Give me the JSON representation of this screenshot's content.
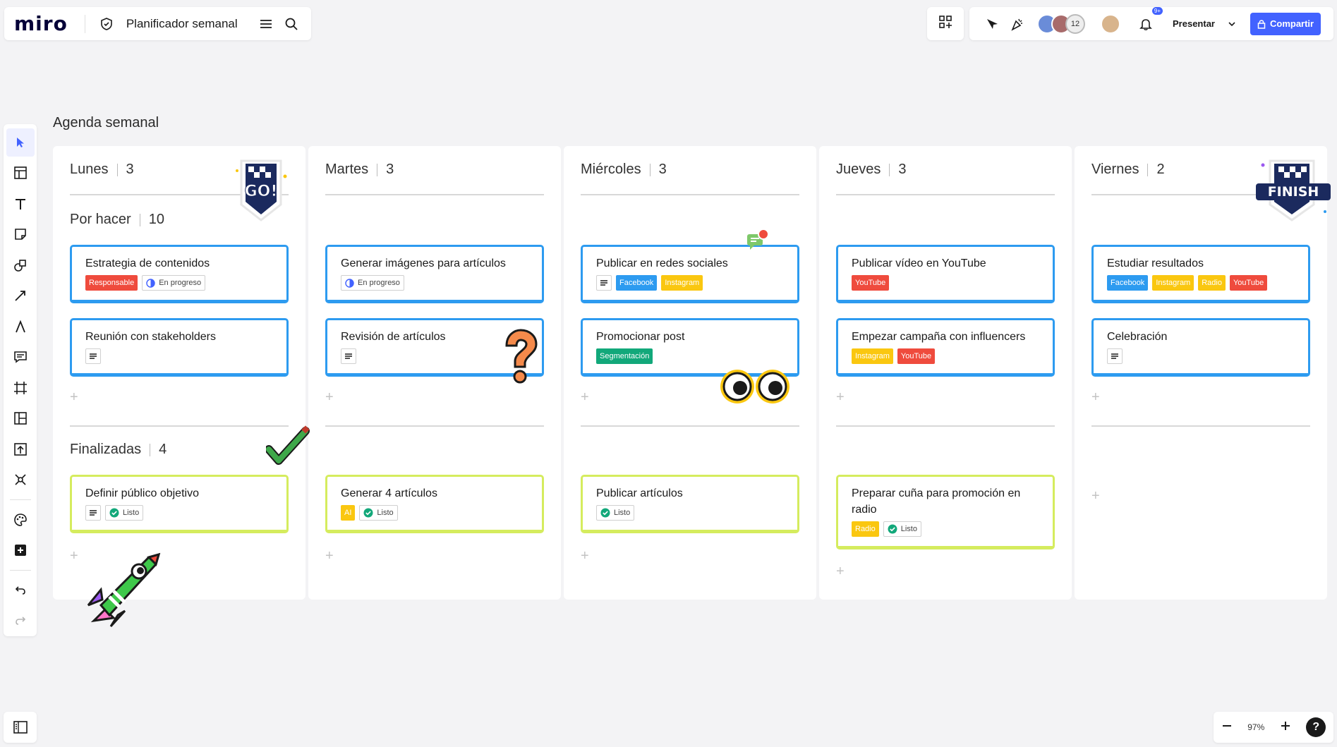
{
  "app": {
    "logo": "miro",
    "board_title": "Planificador semanal"
  },
  "topbar": {
    "avatar_count": "12",
    "notifications_badge": "9+",
    "present_label": "Presentar",
    "share_label": "Compartir"
  },
  "zoom": {
    "level": "97%",
    "help": "?"
  },
  "board": {
    "title": "Agenda semanal",
    "group_todo": "Por hacer",
    "group_todo_count": "10",
    "group_done": "Finalizadas",
    "group_done_count": "4",
    "columns": [
      {
        "day": "Lunes",
        "count": "3",
        "todo": [
          {
            "title": "Estrategia de contenidos",
            "tags": [
              {
                "label": "Responsable",
                "color": "#ef4b3d"
              },
              {
                "label": "En progreso",
                "kind": "status-progress"
              }
            ]
          },
          {
            "title": "Reunión con stakeholders",
            "note": true
          }
        ],
        "done": [
          {
            "title": "Definir público objetivo",
            "note": true,
            "tags": [
              {
                "label": "Listo",
                "kind": "status-done"
              }
            ]
          }
        ]
      },
      {
        "day": "Martes",
        "count": "3",
        "todo": [
          {
            "title": "Generar imágenes para artículos",
            "tags": [
              {
                "label": "En progreso",
                "kind": "status-progress"
              }
            ]
          },
          {
            "title": "Revisión de artículos",
            "note": true
          }
        ],
        "done": [
          {
            "title": "Generar 4 artículos",
            "tags": [
              {
                "label": "AI",
                "color": "#fac710"
              },
              {
                "label": "Listo",
                "kind": "status-done"
              }
            ]
          }
        ]
      },
      {
        "day": "Miércoles",
        "count": "3",
        "todo": [
          {
            "title": "Publicar en redes sociales",
            "note": true,
            "tags": [
              {
                "label": "Facebook",
                "color": "#2d9bf0"
              },
              {
                "label": "Instagram",
                "color": "#fac710"
              }
            ]
          },
          {
            "title": "Promocionar post",
            "tags": [
              {
                "label": "Segmentación",
                "color": "#12a87a"
              }
            ]
          }
        ],
        "done": [
          {
            "title": "Publicar artículos",
            "tags": [
              {
                "label": "Listo",
                "kind": "status-done"
              }
            ]
          }
        ]
      },
      {
        "day": "Jueves",
        "count": "3",
        "todo": [
          {
            "title": "Publicar vídeo en YouTube",
            "tags": [
              {
                "label": "YouTube",
                "color": "#ef4b3d"
              }
            ]
          },
          {
            "title": "Empezar campaña con influencers",
            "tags": [
              {
                "label": "Instagram",
                "color": "#fac710"
              },
              {
                "label": "YouTube",
                "color": "#ef4b3d"
              }
            ]
          }
        ],
        "done": [
          {
            "title": "Preparar cuña para promoción en radio",
            "tags": [
              {
                "label": "Radio",
                "color": "#fac710"
              },
              {
                "label": "Listo",
                "kind": "status-done"
              }
            ]
          }
        ]
      },
      {
        "day": "Viernes",
        "count": "2",
        "todo": [
          {
            "title": "Estudiar resultados",
            "tags": [
              {
                "label": "Facebook",
                "color": "#2d9bf0"
              },
              {
                "label": "Instagram",
                "color": "#fac710"
              },
              {
                "label": "Radio",
                "color": "#fac710"
              },
              {
                "label": "YouTube",
                "color": "#ef4b3d"
              }
            ]
          },
          {
            "title": "Celebración",
            "note": true
          }
        ],
        "done": []
      }
    ]
  },
  "stickers": {
    "go": "GO!",
    "finish": "FINISH"
  },
  "colors": {
    "accent": "#4262ff",
    "card_todo_border": "#2d9bf0",
    "card_done_border": "#d5ec5e"
  }
}
